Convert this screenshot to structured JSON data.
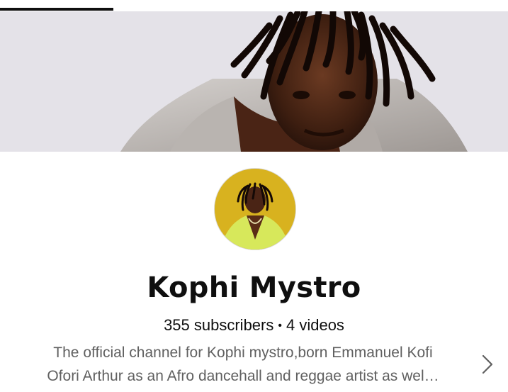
{
  "channel": {
    "name": "Kophi Mystro",
    "subscribers": "355 subscribers",
    "separator": "•",
    "videos": "4 videos",
    "description_line1": "The official channel for Kophi mystro,born Emmanuel Kofi",
    "description_line2": "Ofori Arthur as an Afro dancehall and reggae artist as wel…"
  },
  "icons": {
    "more": "chevron-right-icon"
  },
  "colors": {
    "text_primary": "#0f0f0f",
    "text_secondary": "#606060",
    "avatar_background": "#d8b21f",
    "banner_background": "#e4e2e8"
  }
}
